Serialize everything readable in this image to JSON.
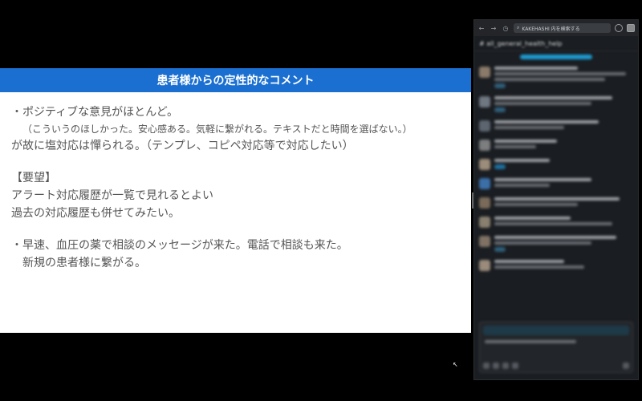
{
  "slide": {
    "title": "患者様からの定性的なコメント",
    "lines": [
      "・ポジティブな意見がほとんど。",
      "（こういうのほしかった。安心感ある。気軽に繋がれる。テキストだと時間を選ばない。）",
      "が故に塩対応は憚られる。（テンプレ、コピペ対応等で対応したい）",
      "【要望】",
      "アラート対応履歴が一覧で見れるとよい",
      "過去の対応履歴も併せてみたい。",
      "・早速、血圧の薬で相談のメッセージが来た。電話で相談も来た。",
      "新規の患者様に繋がる。"
    ]
  },
  "sidebar": {
    "search_placeholder": "KAKEHASHI 内を検索する",
    "channel_name": "# all_general_health_help"
  },
  "colors": {
    "header_bg": "#1a6fd0",
    "slide_text": "#555555",
    "sidebar_bg": "#1a1d21"
  }
}
